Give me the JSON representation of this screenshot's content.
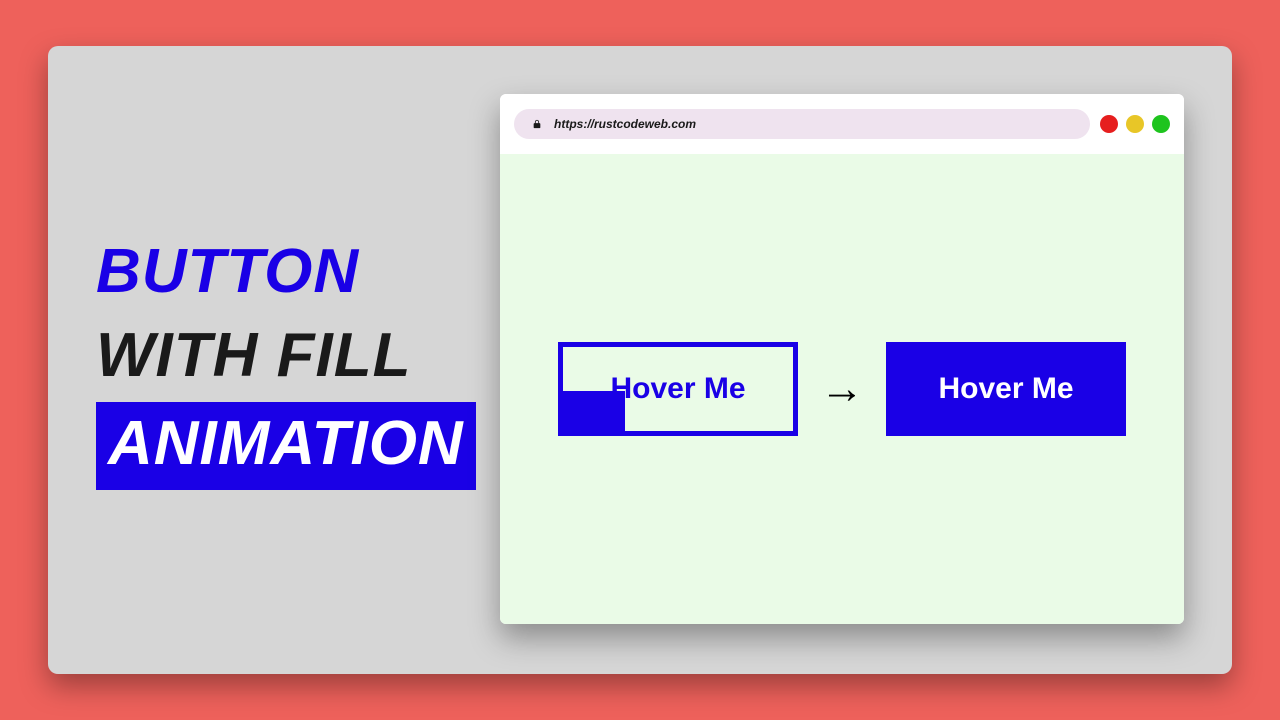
{
  "title": {
    "line1": "BUTTON",
    "line2": "WITH FILL",
    "line3": "ANIMATION"
  },
  "browser": {
    "url": "https://rustcodeweb.com"
  },
  "demo": {
    "button_before": "Hover Me",
    "button_after": "Hover Me",
    "arrow": "→"
  },
  "colors": {
    "page_bg": "#ee615b",
    "card_bg": "#d6d6d6",
    "accent": "#1a00e6",
    "viewport": "#eafbe7"
  }
}
